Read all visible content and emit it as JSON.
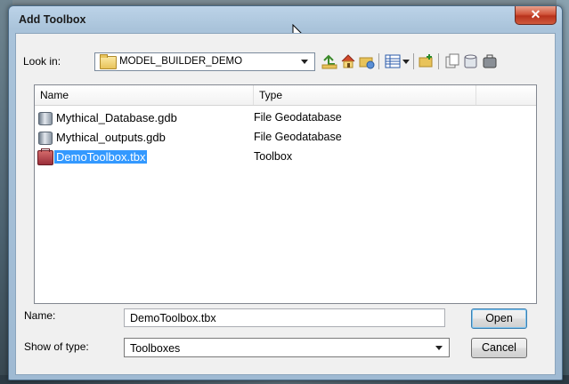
{
  "window": {
    "title": "Add Toolbox",
    "close_symbol": "✕"
  },
  "look_in": {
    "label": "Look in:",
    "value": "MODEL_BUILDER_DEMO"
  },
  "toolbar": {
    "icons": [
      "up-one-level-icon",
      "home-icon",
      "connect-folder-icon",
      "view-details-icon",
      "new-folder-icon",
      "copy-icon",
      "new-database-icon",
      "new-toolbox-icon"
    ]
  },
  "list": {
    "columns": {
      "name": "Name",
      "type": "Type"
    },
    "rows": [
      {
        "name": "Mythical_Database.gdb",
        "type": "File Geodatabase",
        "icon": "geodatabase-icon",
        "selected": false
      },
      {
        "name": "Mythical_outputs.gdb",
        "type": "File Geodatabase",
        "icon": "geodatabase-icon",
        "selected": false
      },
      {
        "name": "DemoToolbox.tbx",
        "type": "Toolbox",
        "icon": "toolbox-icon",
        "selected": true
      }
    ]
  },
  "name_field": {
    "label": "Name:",
    "value": "DemoToolbox.tbx"
  },
  "type_field": {
    "label": "Show of type:",
    "value": "Toolboxes"
  },
  "buttons": {
    "open": "Open",
    "cancel": "Cancel"
  },
  "colors": {
    "selection": "#3399ff",
    "title_bar": "#a9c3da",
    "close_button": "#c8452b"
  }
}
